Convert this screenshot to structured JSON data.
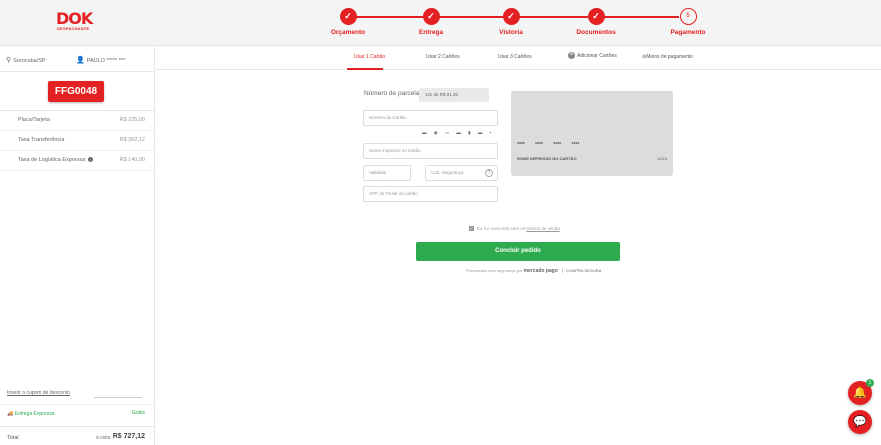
{
  "logo": {
    "main": "DOK",
    "sub": "DESPACHANTE"
  },
  "steps": [
    {
      "label": "Orçamento",
      "state": "done",
      "mark": "✓"
    },
    {
      "label": "Entrega",
      "state": "done",
      "mark": "✓"
    },
    {
      "label": "Vistoria",
      "state": "done",
      "mark": "✓"
    },
    {
      "label": "Documentos",
      "state": "done",
      "mark": "✓"
    },
    {
      "label": "Pagamento",
      "state": "current",
      "mark": "5"
    }
  ],
  "sidebar": {
    "location": "Sorocaba/SP",
    "user": "PAULO *****  ***",
    "plate": "FFG0048",
    "fees": [
      {
        "name": "Placa/Tarjeta",
        "value": "R$ 225,00"
      },
      {
        "name": "Taxa Transferência",
        "value": "R$ 362,12"
      },
      {
        "name": "Taxa de Logística Expressa",
        "value": "R$ 140,00",
        "info": true
      }
    ],
    "coupon_link": "Inserir o cupom de desconto",
    "express": {
      "label": "Entrega Expressa",
      "value": "Grátis"
    },
    "total": {
      "label": "Total",
      "prefix": "à vista",
      "value": "R$ 727,12"
    }
  },
  "tabs": [
    {
      "label": "Usar 1 Cartão",
      "active": true
    },
    {
      "label": "Usar 2 Cartões",
      "active": false
    },
    {
      "label": "Usar 3 Cartões",
      "active": false
    },
    {
      "label": "Adicionar Cartões",
      "active": false
    },
    {
      "label": "Meios de pagamento",
      "active": false
    }
  ],
  "form": {
    "installments_label": "Número de parcelas",
    "installments_value": "12x de R$ 81,20",
    "card_number_placeholder": "Número do Cartão",
    "brands": "VISA MC ELO AMEX HIPER DIN",
    "holder_placeholder": "Nome impresso no cartão",
    "expiry_placeholder": "Validade",
    "cvv_placeholder": "Cód. Segurança",
    "cpf_placeholder": "CPF do Titular do cartão",
    "terms_text": "Eu li e concordo com os",
    "terms_link": "termos de venda",
    "submit_label": "Concluir pedido",
    "secure_prefix": "Processado com segurança por",
    "secure_brand": "mercado pago",
    "secure_badge": "COMPRA SEGURA"
  },
  "card_preview": {
    "number": "**** **** **** ****",
    "holder": "NOME IMPRESSO NO CARTÃO",
    "expiry": "12/16"
  },
  "fab_notifications_count": "1",
  "colors": {
    "brand": "#e42122",
    "success": "#2eab4f"
  }
}
